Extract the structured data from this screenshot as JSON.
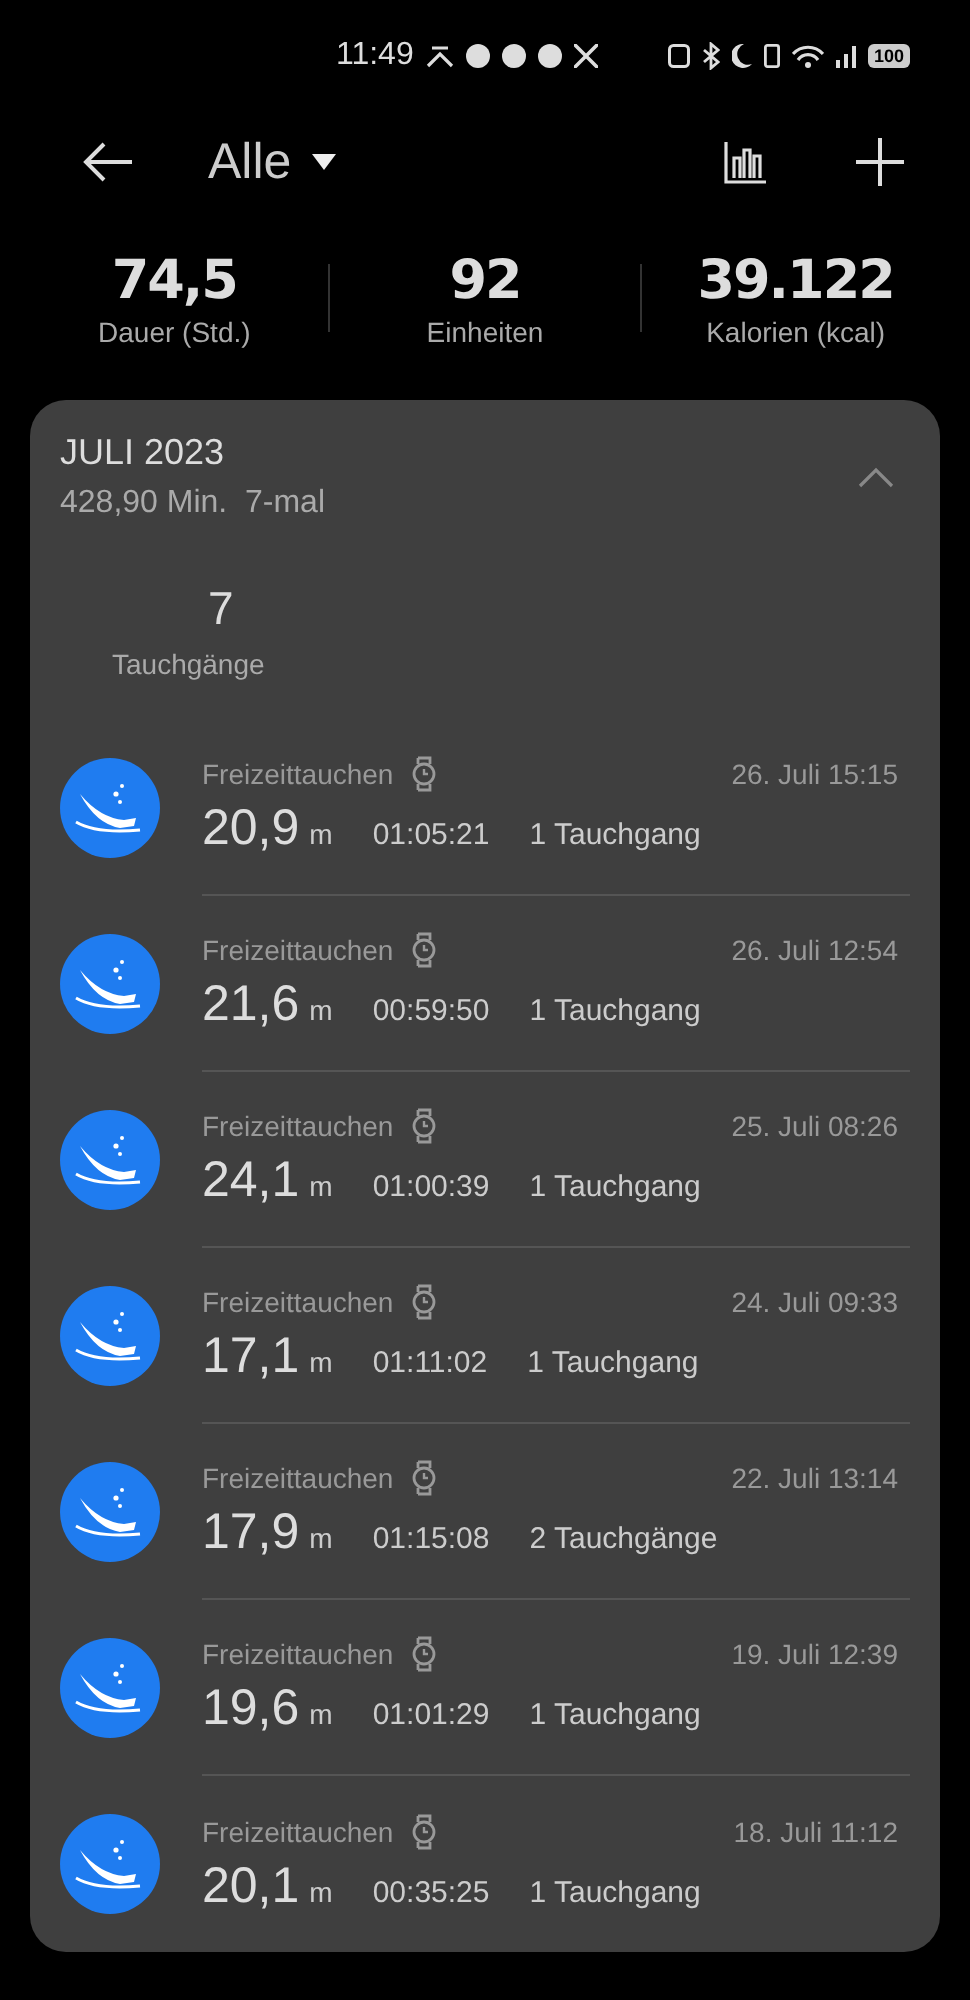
{
  "status_bar": {
    "time": "11:49",
    "battery": "100"
  },
  "header": {
    "title": "Alle"
  },
  "stats": [
    {
      "value": "74,5",
      "label": "Dauer (Std.)"
    },
    {
      "value": "92",
      "label": "Einheiten"
    },
    {
      "value": "39.122",
      "label": "Kalorien (kcal)"
    }
  ],
  "month": {
    "title": "JULI 2023",
    "summary": "428,90 Min.  7-mal",
    "expanded": true,
    "count": "7",
    "count_label": "Tauchgänge"
  },
  "dives": [
    {
      "type": "Freizeittauchen",
      "date": "26. Juli 15:15",
      "depth": "20,9",
      "unit": "m",
      "duration": "01:05:21",
      "dives": "1 Tauchgang"
    },
    {
      "type": "Freizeittauchen",
      "date": "26. Juli 12:54",
      "depth": "21,6",
      "unit": "m",
      "duration": "00:59:50",
      "dives": "1 Tauchgang"
    },
    {
      "type": "Freizeittauchen",
      "date": "25. Juli 08:26",
      "depth": "24,1",
      "unit": "m",
      "duration": "01:00:39",
      "dives": "1 Tauchgang"
    },
    {
      "type": "Freizeittauchen",
      "date": "24. Juli 09:33",
      "depth": "17,1",
      "unit": "m",
      "duration": "01:11:02",
      "dives": "1 Tauchgang"
    },
    {
      "type": "Freizeittauchen",
      "date": "22. Juli 13:14",
      "depth": "17,9",
      "unit": "m",
      "duration": "01:15:08",
      "dives": "2 Tauchgänge"
    },
    {
      "type": "Freizeittauchen",
      "date": "19. Juli 12:39",
      "depth": "19,6",
      "unit": "m",
      "duration": "01:01:29",
      "dives": "1 Tauchgang"
    },
    {
      "type": "Freizeittauchen",
      "date": "18. Juli 11:12",
      "depth": "20,1",
      "unit": "m",
      "duration": "00:35:25",
      "dives": "1 Tauchgang"
    }
  ]
}
